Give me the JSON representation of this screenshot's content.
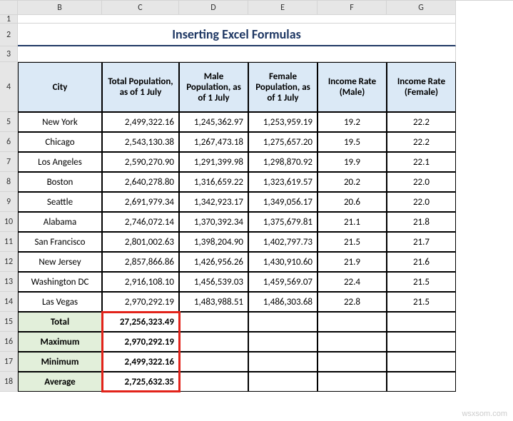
{
  "columns": [
    "B",
    "C",
    "D",
    "E",
    "F",
    "G"
  ],
  "title": "Inserting Excel Formulas",
  "headers": [
    "City",
    "Total Population, as of 1 July",
    "Male Population, as of 1 July",
    "Female Population, as of 1 July",
    "Income Rate (Male)",
    "Income Rate (Female)"
  ],
  "rows": [
    {
      "label": "New York",
      "total": "2,499,322.16",
      "male": "1,245,362.97",
      "female": "1,253,959.19",
      "ir_m": "19.2",
      "ir_f": "22.2"
    },
    {
      "label": "Chicago",
      "total": "2,543,130.38",
      "male": "1,267,473.18",
      "female": "1,275,657.20",
      "ir_m": "19.5",
      "ir_f": "22.2"
    },
    {
      "label": "Los Angeles",
      "total": "2,590,270.90",
      "male": "1,291,399.98",
      "female": "1,298,870.92",
      "ir_m": "19.9",
      "ir_f": "22.1"
    },
    {
      "label": "Boston",
      "total": "2,640,278.80",
      "male": "1,316,659.22",
      "female": "1,323,619.57",
      "ir_m": "20.2",
      "ir_f": "22.0"
    },
    {
      "label": "Seattle",
      "total": "2,691,979.34",
      "male": "1,342,923.17",
      "female": "1,349,056.17",
      "ir_m": "20.6",
      "ir_f": "22.0"
    },
    {
      "label": "Alabama",
      "total": "2,746,072.14",
      "male": "1,370,392.34",
      "female": "1,375,679.81",
      "ir_m": "21.1",
      "ir_f": "21.8"
    },
    {
      "label": "San Francisco",
      "total": "2,801,002.63",
      "male": "1,398,204.90",
      "female": "1,402,797.73",
      "ir_m": "21.5",
      "ir_f": "21.7"
    },
    {
      "label": "New Jersey",
      "total": "2,857,866.86",
      "male": "1,426,956.26",
      "female": "1,430,910.60",
      "ir_m": "21.9",
      "ir_f": "21.6"
    },
    {
      "label": "Washington DC",
      "total": "2,916,108.10",
      "male": "1,456,539.03",
      "female": "1,459,569.07",
      "ir_m": "22.4",
      "ir_f": "21.5"
    },
    {
      "label": "Las Vegas",
      "total": "2,970,292.19",
      "male": "1,483,988.51",
      "female": "1,486,303.68",
      "ir_m": "22.8",
      "ir_f": "21.5"
    }
  ],
  "summary": [
    {
      "label": "Total",
      "value": "27,256,323.49"
    },
    {
      "label": "Maximum",
      "value": "2,970,292.19"
    },
    {
      "label": "Minimum",
      "value": "2,499,322.16"
    },
    {
      "label": "Average",
      "value": "2,725,632.35"
    }
  ],
  "row_numbers": [
    "1",
    "2",
    "3",
    "4",
    "5",
    "6",
    "7",
    "8",
    "9",
    "10",
    "11",
    "12",
    "13",
    "14",
    "15",
    "16",
    "17",
    "18"
  ],
  "watermark": "wsxsom.com"
}
